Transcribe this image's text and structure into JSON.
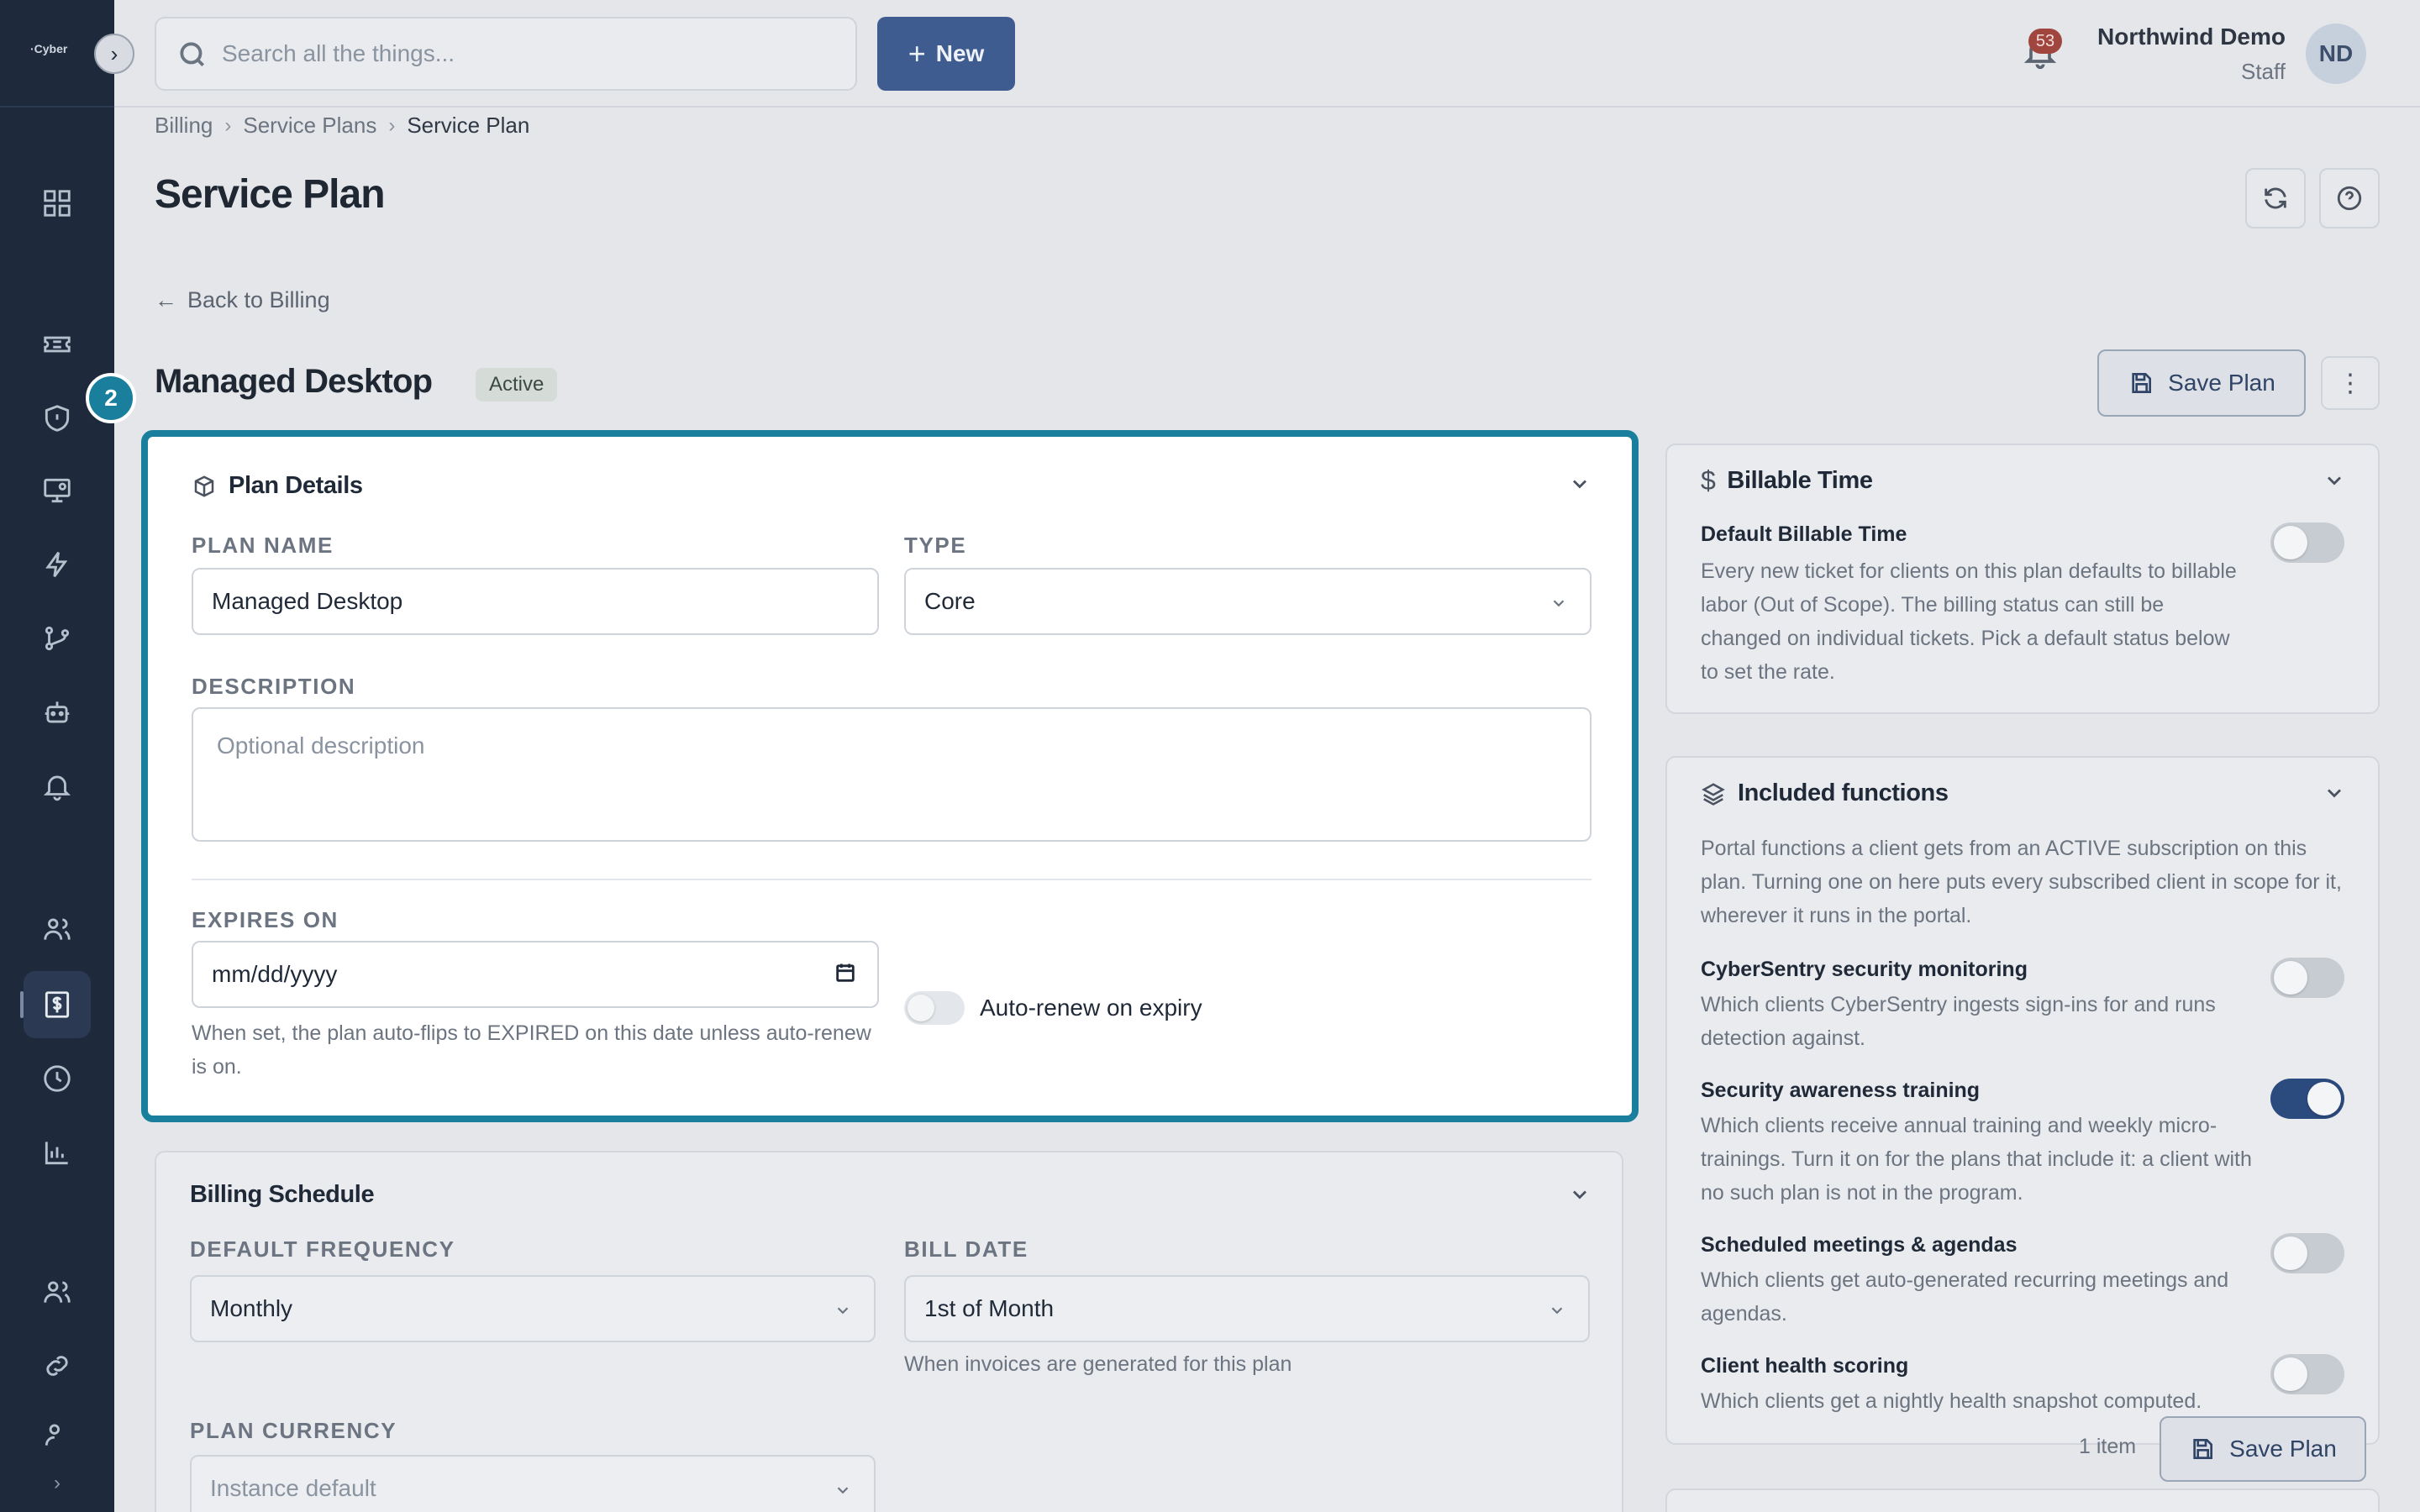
{
  "app": {
    "logo_text": "·Cyber"
  },
  "topbar": {
    "search_placeholder": "Search all the things...",
    "new_label": "New",
    "notification_count": "53",
    "user_name": "Northwind Demo",
    "user_role": "Staff",
    "avatar_initials": "ND"
  },
  "breadcrumb": [
    "Billing",
    "Service Plans",
    "Service Plan"
  ],
  "page": {
    "title": "Service Plan",
    "back_label": "Back to Billing",
    "plan_name": "Managed Desktop",
    "status": "Active",
    "save_label": "Save Plan",
    "step_number": "2"
  },
  "plan_details": {
    "title": "Plan Details",
    "plan_name_label": "PLAN NAME",
    "plan_name_value": "Managed Desktop",
    "type_label": "TYPE",
    "type_value": "Core",
    "description_label": "DESCRIPTION",
    "description_placeholder": "Optional description",
    "expires_label": "EXPIRES ON",
    "expires_placeholder": "mm/dd/yyyy",
    "expires_hint": "When set, the plan auto-flips to EXPIRED on this date unless auto-renew is on.",
    "auto_renew_label": "Auto-renew on expiry",
    "auto_renew": false
  },
  "billing_schedule": {
    "title": "Billing Schedule",
    "frequency_label": "DEFAULT FREQUENCY",
    "frequency_value": "Monthly",
    "bill_date_label": "BILL DATE",
    "bill_date_value": "1st of Month",
    "bill_date_hint": "When invoices are generated for this plan",
    "currency_label": "PLAN CURRENCY",
    "currency_value": "Instance default"
  },
  "billable_time": {
    "title": "Billable Time",
    "item_title": "Default Billable Time",
    "item_desc": "Every new ticket for clients on this plan defaults to billable labor (Out of Scope). The billing status can still be changed on individual tickets. Pick a default status below to set the rate.",
    "enabled": false
  },
  "included_functions": {
    "title": "Included functions",
    "intro": "Portal functions a client gets from an ACTIVE subscription on this plan. Turning one on here puts every subscribed client in scope for it, wherever it runs in the portal.",
    "items": [
      {
        "title": "CyberSentry security monitoring",
        "desc": "Which clients CyberSentry ingests sign-ins for and runs detection against.",
        "enabled": false
      },
      {
        "title": "Security awareness training",
        "desc": "Which clients receive annual training and weekly micro-trainings. Turn it on for the plans that include it: a client with no such plan is not in the program.",
        "enabled": true
      },
      {
        "title": "Scheduled meetings & agendas",
        "desc": "Which clients get auto-generated recurring meetings and agendas.",
        "enabled": false
      },
      {
        "title": "Client health scoring",
        "desc": "Which clients get a nightly health snapshot computed.",
        "enabled": false
      }
    ]
  },
  "footer": {
    "items_count": "1 item",
    "save_label": "Save Plan"
  },
  "colors": {
    "accent": "#1a7f9c",
    "primary": "#3f5c90",
    "sidebar": "#1e2a3c"
  }
}
